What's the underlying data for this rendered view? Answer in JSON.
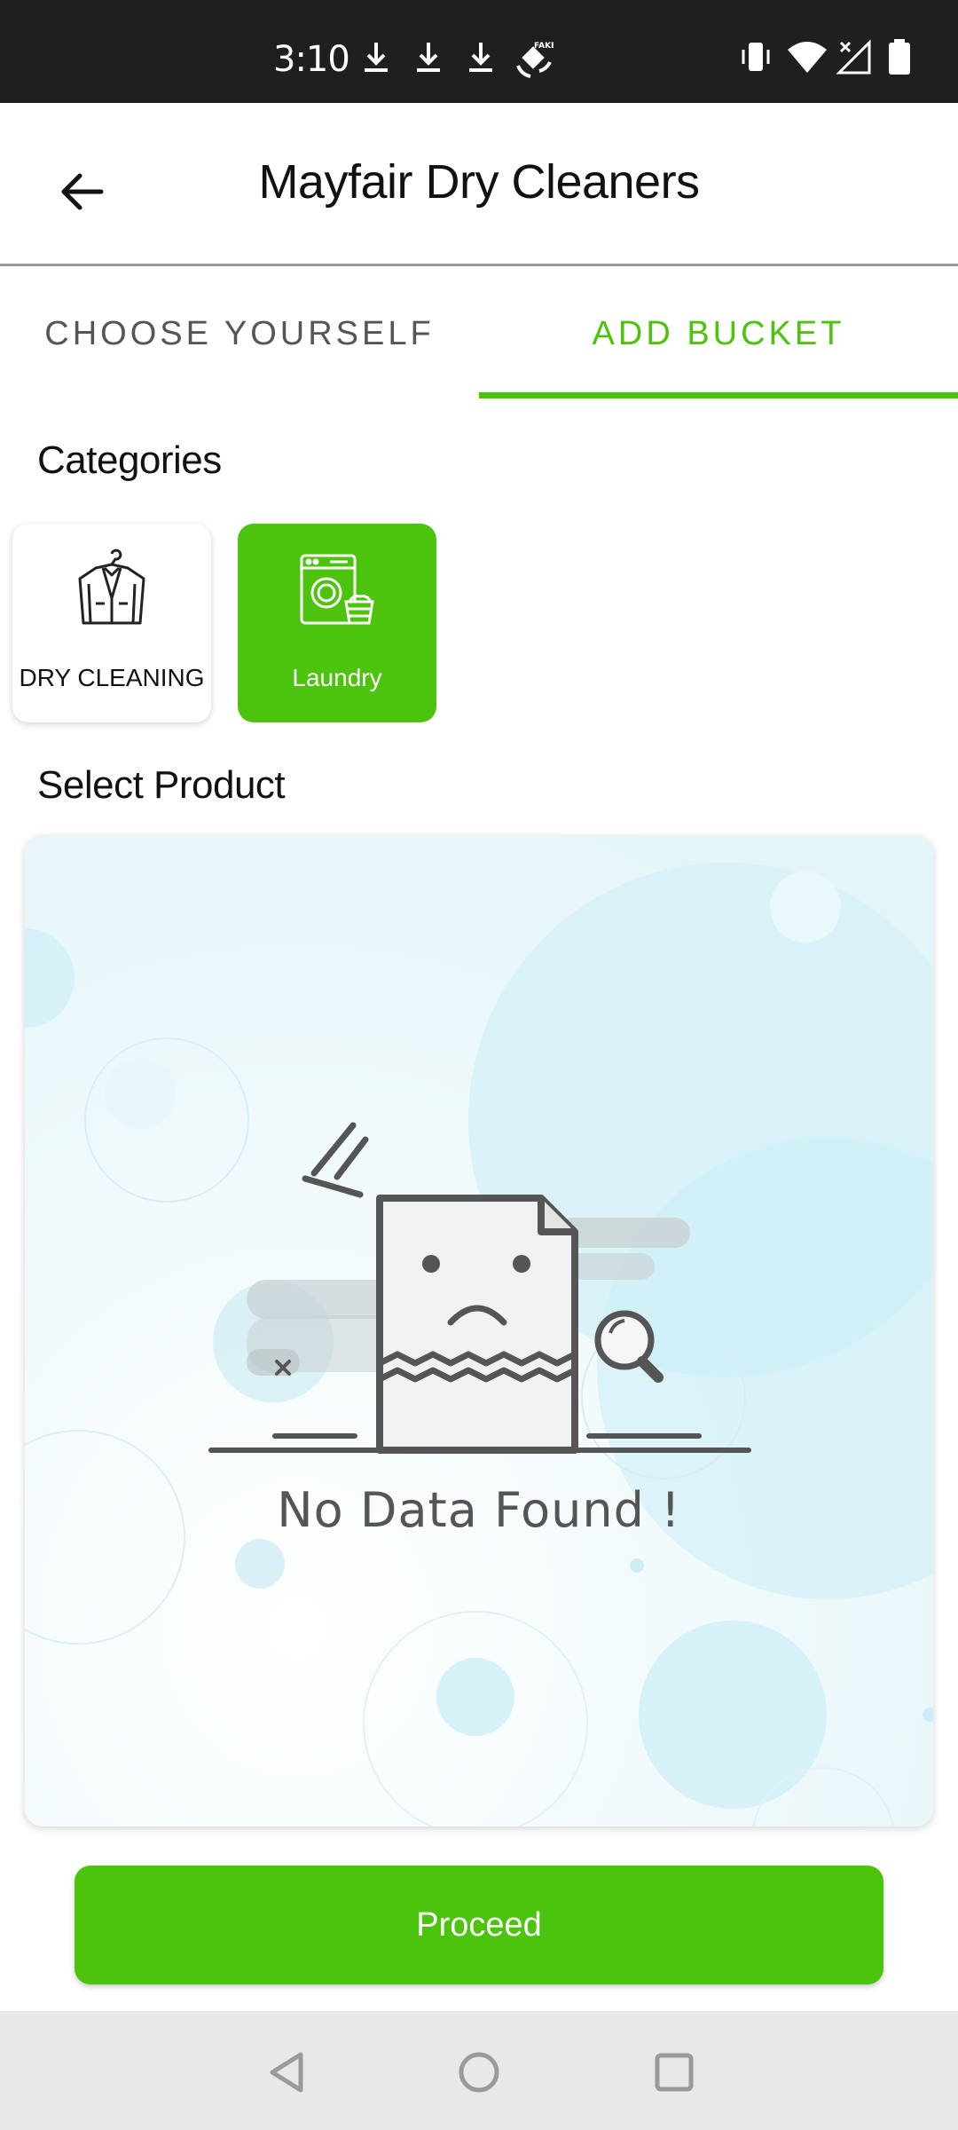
{
  "status_bar": {
    "time": "3:10",
    "icons": [
      "download-icon",
      "download-icon",
      "download-icon",
      "fake-gps-icon",
      "vibrate-icon",
      "wifi-icon",
      "no-signal-icon",
      "battery-icon"
    ]
  },
  "header": {
    "title": "Mayfair Dry Cleaners",
    "back_icon": "arrow-left-icon"
  },
  "tabs": [
    {
      "label": "CHOOSE YOURSELF",
      "selected": false
    },
    {
      "label": "ADD BUCKET",
      "selected": true
    }
  ],
  "categories": {
    "heading": "Categories",
    "items": [
      {
        "label": "DRY CLEANING",
        "icon": "suit-on-hanger-icon",
        "selected": false
      },
      {
        "label": "Laundry",
        "icon": "washing-machine-icon",
        "selected": true
      }
    ]
  },
  "products": {
    "heading": "Select Product",
    "empty_message": "No Data Found !"
  },
  "actions": {
    "proceed_label": "Proceed"
  },
  "nav_bar": {
    "icons": [
      "back-triangle-icon",
      "home-circle-icon",
      "recents-square-icon"
    ]
  },
  "colors": {
    "accent": "#4cc30c",
    "status_bar_bg": "#1f1f1f",
    "nav_bar_bg": "#e8e8e8"
  }
}
